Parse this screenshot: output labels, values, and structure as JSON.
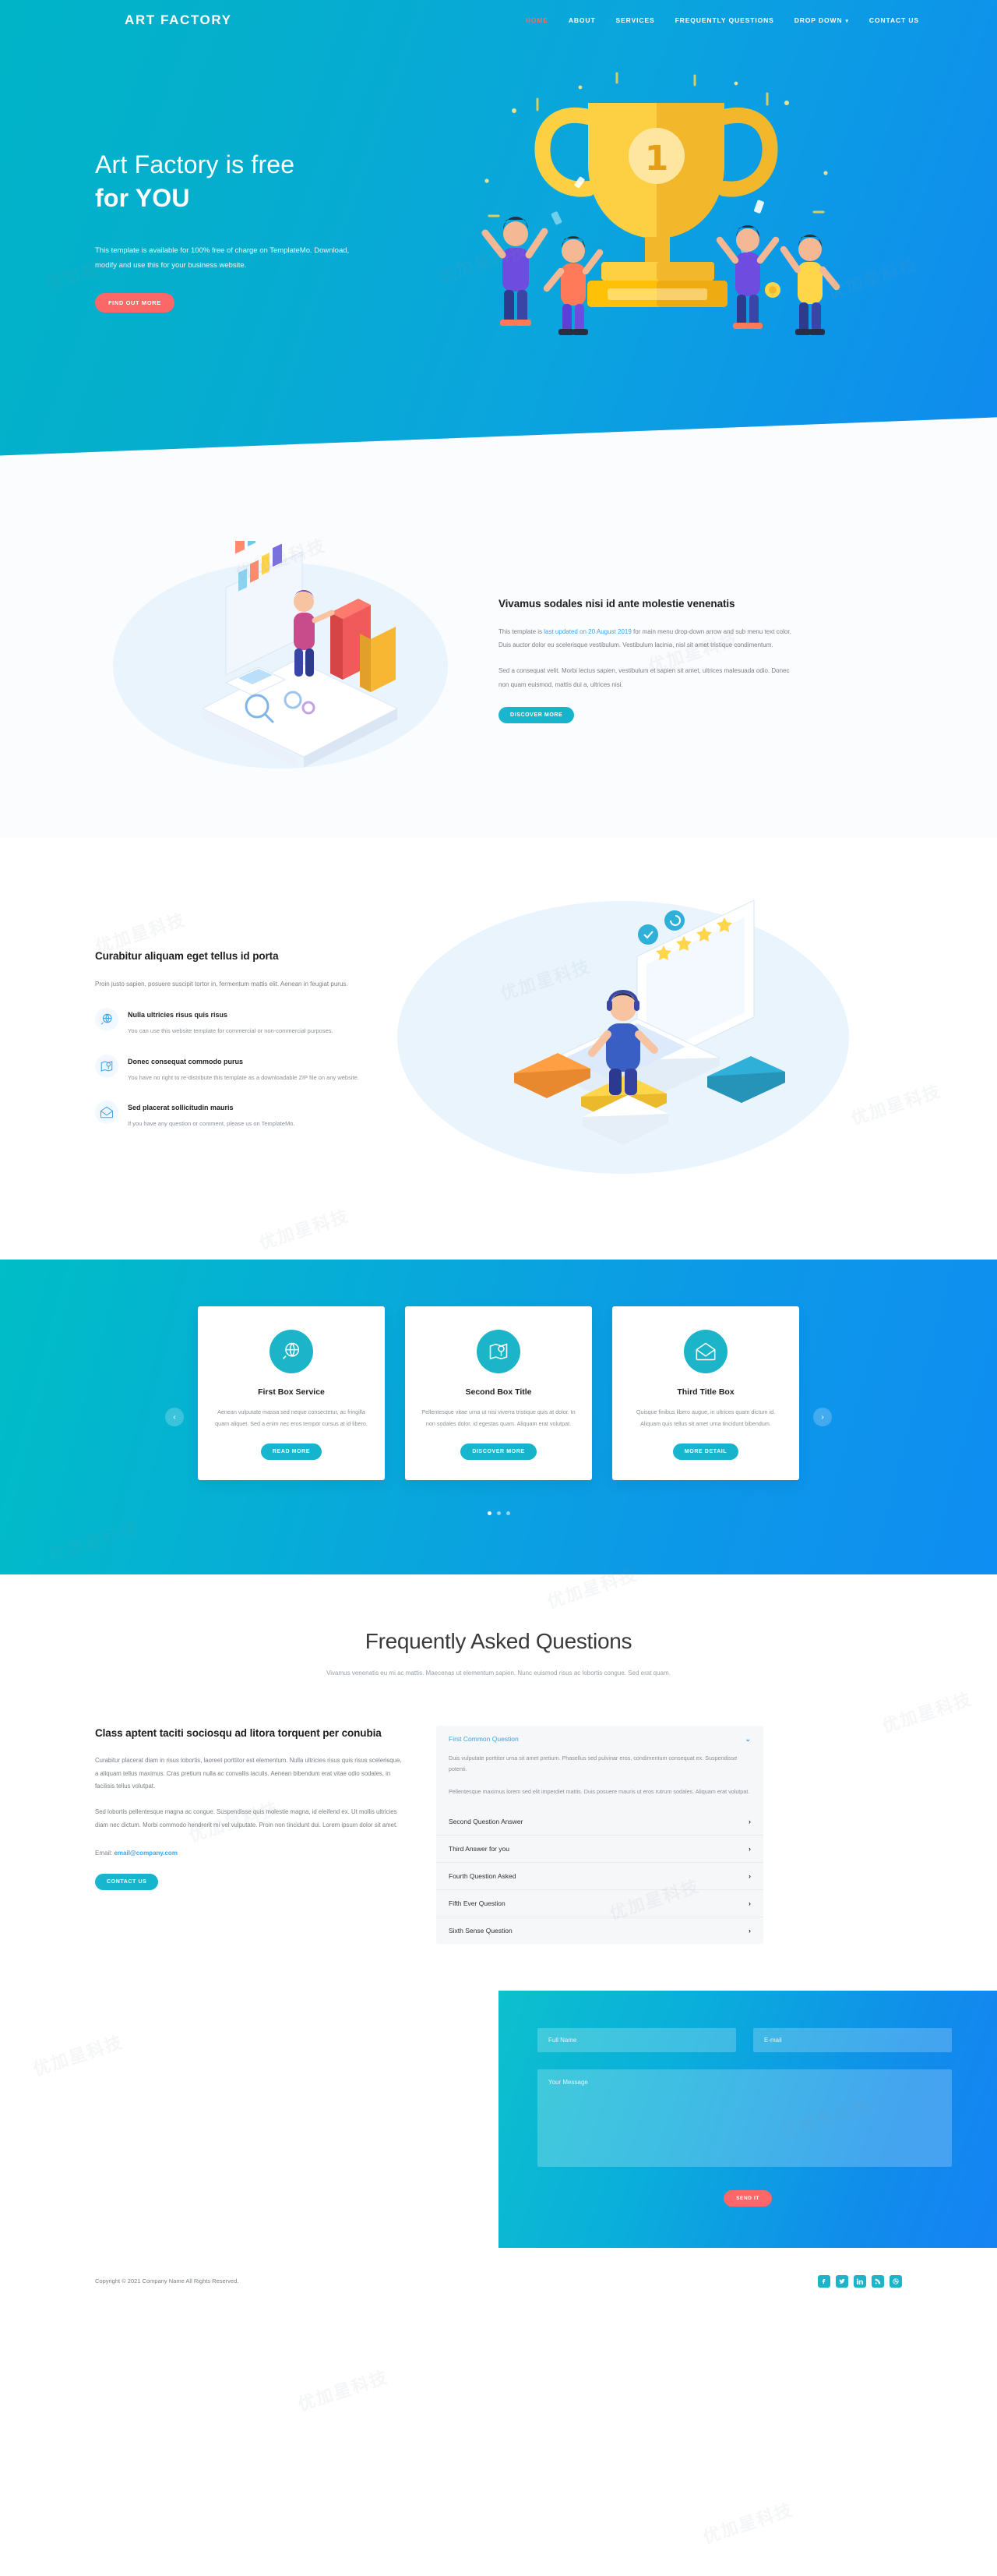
{
  "brand": {
    "logo": "ART FACTORY",
    "accent": "#1cb4c8",
    "red": "#fc6767",
    "blue": "#3ba3e8"
  },
  "nav": {
    "items": [
      {
        "label": "HOME",
        "active": true
      },
      {
        "label": "ABOUT",
        "active": false
      },
      {
        "label": "SERVICES",
        "active": false
      },
      {
        "label": "FREQUENTLY QUESTIONS",
        "active": false
      },
      {
        "label": "DROP DOWN",
        "active": false,
        "caret": "▾"
      },
      {
        "label": "CONTACT US",
        "active": false
      }
    ]
  },
  "hero": {
    "title_line1": "Art Factory is free",
    "title_line2": "for YOU",
    "paragraph": "This template is available for 100% free of charge on TemplateMo. Download, modify and use this for your business website.",
    "cta": "FIND OUT MORE",
    "trophy_number": "1"
  },
  "about": {
    "heading": "Vivamus sodales nisi id ante molestie venenatis",
    "p1_before": "This template is ",
    "p1_link": "last updated on 20 August 2019",
    "p1_after": " for main menu drop-down arrow and sub menu text color. Duis auctor dolor eu scelerisque vestibulum. Vestibulum lacinia, nisl sit amet tristique condimentum.",
    "p2": "Sed a consequat velit. Morbi lectus sapien, vestibulum et sapien sit amet, ultrices malesuada odio. Donec non quam euismod, mattis dui a, ultrices nisi.",
    "cta": "DISCOVER MORE"
  },
  "features": {
    "heading": "Curabitur aliquam eget tellus id porta",
    "intro": "Proin justo sapien, posuere suscipit tortor in, fermentum mattis elit. Aenean in feugiat purus.",
    "items": [
      {
        "icon": "magnifier-globe-icon",
        "title": "Nulla ultricies risus quis risus",
        "text": "You can use this website template for commercial or non-commercial purposes."
      },
      {
        "icon": "map-pin-icon",
        "title": "Donec consequat commodo purus",
        "text": "You have no right to re-distribute this template as a downloadable ZIP file on any website."
      },
      {
        "icon": "mail-open-icon",
        "title": "Sed placerat sollicitudin mauris",
        "text": "If you have any question or comment, please us on TemplateMo."
      }
    ]
  },
  "boxes": {
    "prev_icon": "‹",
    "next_icon": "›",
    "items": [
      {
        "icon": "magnifier-globe-icon",
        "title": "First Box Service",
        "text": "Aenean vulputate massa sed neque consectetur, ac fringilla quam aliquet. Sed a enim nec eros tempor cursus at id libero.",
        "cta": "READ MORE"
      },
      {
        "icon": "map-pin-icon",
        "title": "Second Box Title",
        "text": "Pellentesque vitae urna ut nisi viverra tristique quis at dolor. In non sodales dolor, id egestas quam. Aliquam erat volutpat.",
        "cta": "DISCOVER MORE"
      },
      {
        "icon": "mail-open-icon",
        "title": "Third Title Box",
        "text": "Quisque finibus libero augue, in ultrices quam dictum id. Aliquam quis tellus sit amet urna tincidunt bibendum.",
        "cta": "MORE DETAIL"
      }
    ],
    "dots": 3,
    "active_dot": 0
  },
  "faq": {
    "title": "Frequently Asked Questions",
    "subtitle": "Vivamus venenatis eu mi ac mattis. Maecenas ut elementum sapien. Nunc euismod risus ac lobortis congue. Sed erat quam.",
    "left_heading": "Class aptent taciti sociosqu ad litora torquent per conubia",
    "left_p1": "Curabitur placerat diam in risus lobortis, laoreet porttitor est elementum. Nulla ultricies risus quis risus scelerisque, a aliquam tellus maximus. Cras pretium nulla ac convallis iaculis. Aenean bibendum erat vitae odio sodales, in facilisis tellus volutpat.",
    "left_p2": "Sed lobortis pellentesque magna ac congue. Suspendisse quis molestie magna, id eleifend ex. Ut mollis ultricies diam nec dictum. Morbi commodo hendrerit mi vel vulputate. Proin non tincidunt dui. Lorem ipsum dolor sit amet.",
    "email_label": "Email:",
    "email_value": "email@company.com",
    "cta": "CONTACT US",
    "items": [
      {
        "question": "First Common Question",
        "open": true,
        "answer_p1": "Duis vulputate porttitor urna sit amet pretium. Phasellus sed pulvinar eros, condimentum consequat ex. Suspendisse potenti.",
        "answer_p2": "Pellentesque maximus lorem sed elit imperdiet mattis. Duis posuere mauris ut eros rutrum sodales. Aliquam erat volutpat.",
        "chevron": "⌄"
      },
      {
        "question": "Second Question Answer",
        "open": false,
        "chevron": "›"
      },
      {
        "question": "Third Answer for you",
        "open": false,
        "chevron": "›"
      },
      {
        "question": "Fourth Question Asked",
        "open": false,
        "chevron": "›"
      },
      {
        "question": "Fifth Ever Question",
        "open": false,
        "chevron": "›"
      },
      {
        "question": "Sixth Sense Question",
        "open": false,
        "chevron": "›"
      }
    ]
  },
  "contact": {
    "name_placeholder": "Full Name",
    "email_placeholder": "E-mail",
    "message_placeholder": "Your Message",
    "name_value": "",
    "email_value": "",
    "message_value": "",
    "send": "SEND IT"
  },
  "footer": {
    "copyright": "Copyright © 2021 Company Name All Rights Reserved.",
    "socials": [
      {
        "name": "facebook-icon"
      },
      {
        "name": "twitter-icon"
      },
      {
        "name": "linkedin-icon"
      },
      {
        "name": "rss-icon"
      },
      {
        "name": "dribbble-icon"
      }
    ]
  },
  "watermarks": [
    "优加星科技",
    "优加星科技",
    "优加星科技",
    "优加星科技",
    "优加星科技",
    "优加星科技",
    "优加星科技",
    "优加星科技",
    "优加星科技",
    "优加星科技",
    "优加星科技",
    "优加星科技",
    "优加星科技",
    "优加星科技",
    "优加星科技",
    "优加星科技",
    "优加星科技",
    "优加星科技"
  ]
}
